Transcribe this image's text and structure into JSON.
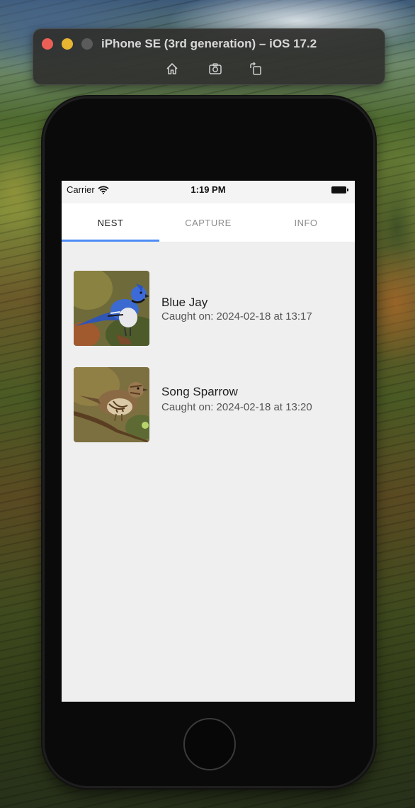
{
  "simulator": {
    "title": "iPhone SE (3rd generation) – iOS 17.2",
    "tools": [
      "home-icon",
      "screenshot-icon",
      "rotate-icon"
    ]
  },
  "status_bar": {
    "carrier": "Carrier",
    "time": "1:19 PM"
  },
  "tabs": [
    {
      "label": "NEST",
      "active": true
    },
    {
      "label": "CAPTURE",
      "active": false
    },
    {
      "label": "INFO",
      "active": false
    }
  ],
  "birds": [
    {
      "name": "Blue Jay",
      "caught": "Caught on: 2024-02-18 at 13:17"
    },
    {
      "name": "Song Sparrow",
      "caught": "Caught on: 2024-02-18 at 13:20"
    }
  ],
  "colors": {
    "tab_indicator": "#4e8df5",
    "screen_background": "#efefef"
  }
}
